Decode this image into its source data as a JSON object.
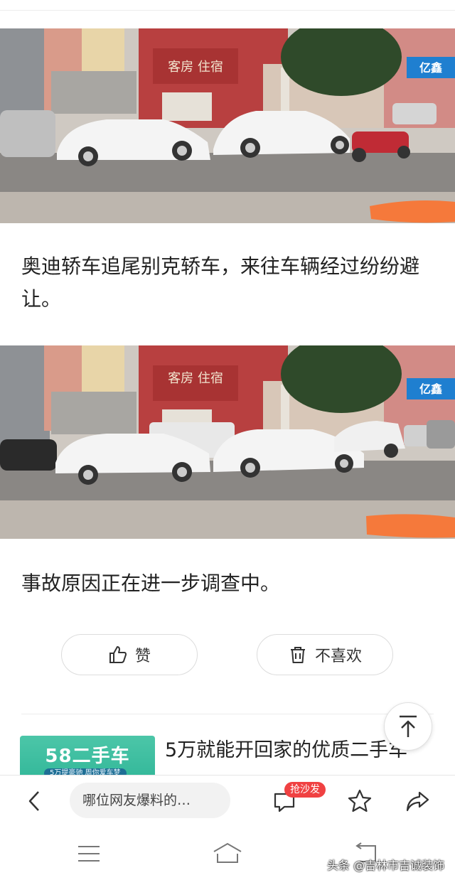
{
  "article": {
    "paragraph1": "奥迪轿车追尾别克轿车，来往车辆经过纷纷避让。",
    "paragraph2": "事故原因正在进一步调查中。"
  },
  "photo1": {
    "sign_text": "客房 住宿",
    "shop_sign": "亿鑫"
  },
  "photo2": {
    "sign_text": "客房 住宿",
    "shop_sign": "亿鑫"
  },
  "actions": {
    "like_label": "赞",
    "dislike_label": "不喜欢"
  },
  "recommend": {
    "thumb_brand": "58二手车",
    "thumb_tag": "5万提豪驰 周你爱车梦",
    "title": "5万就能开回家的优质二手车"
  },
  "bottom_bar": {
    "comment_placeholder": "哪位网友爆料的…",
    "sofa_badge": "抢沙发"
  },
  "watermark": "头条 @吉林市吉诚装饰",
  "colors": {
    "accent_red": "#f04142",
    "thumb_green": "#3dbd9f",
    "redact_orange": "#f5793b"
  }
}
